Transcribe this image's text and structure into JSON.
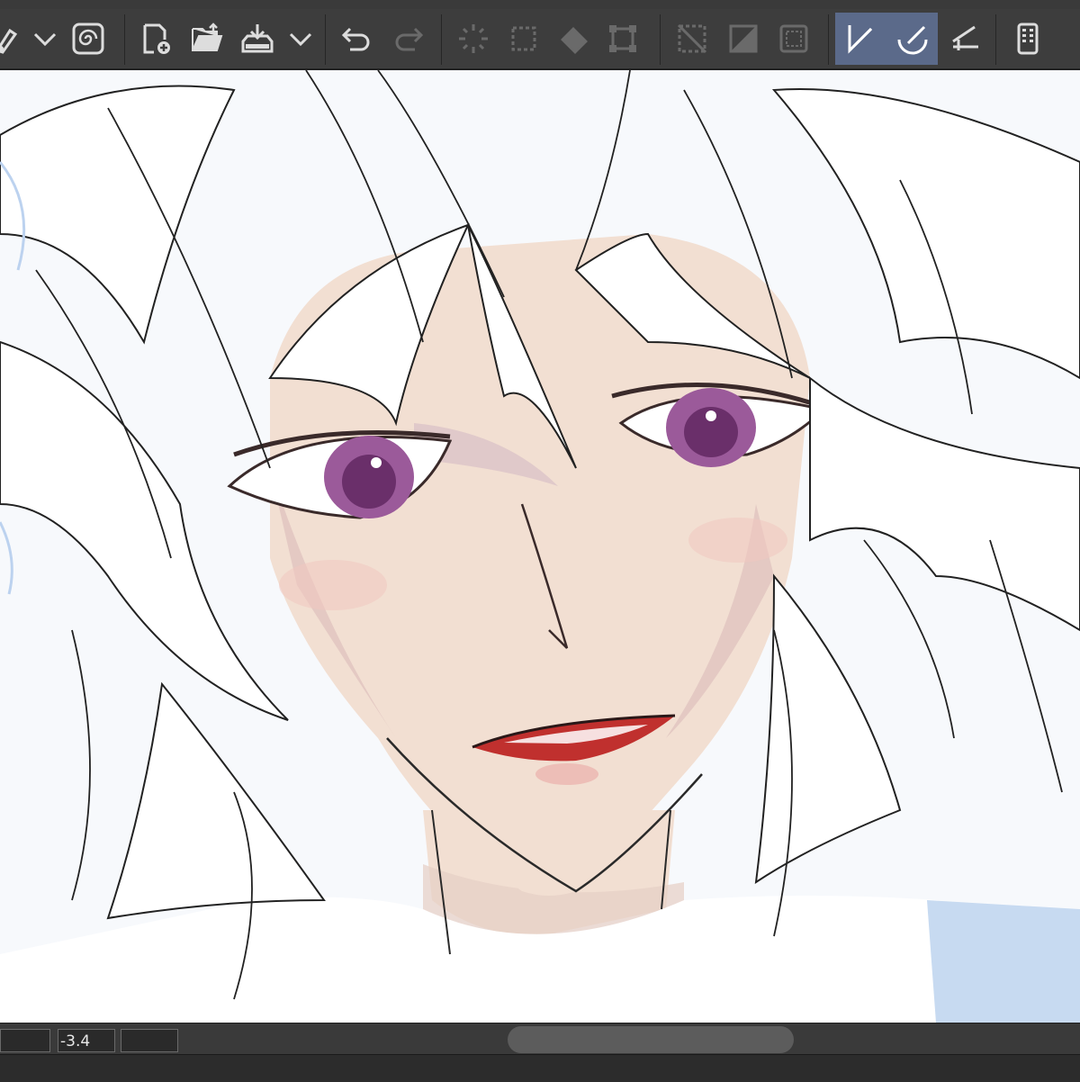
{
  "toolbar": {
    "icons": [
      "pen-icon",
      "dropdown-chevron-icon",
      "swirl-icon",
      "new-file-icon",
      "open-folder-icon",
      "import-icon",
      "dropdown-chevron-icon",
      "undo-icon",
      "redo-icon",
      "clear-selection-icon",
      "select-all-icon",
      "fill-icon",
      "transform-icon",
      "hide-selection-icon",
      "invert-selection-icon",
      "selection-border-icon",
      "ruler-snap-icon",
      "special-ruler-snap-icon",
      "grid-snap-icon",
      "tablet-icon"
    ],
    "active_tool": "ruler-snap-icon"
  },
  "status": {
    "zoom_value": "",
    "rotation_value": "-3.4",
    "blank_value": ""
  },
  "colors": {
    "ui_dark": "#3d3d3d",
    "active_highlight": "#5b6a8a",
    "canvas_bg": "#f7f9fc",
    "skin": "#f2dfd2",
    "iris": "#9b5a9a",
    "lips": "#c0302e",
    "sleeve_blue": "#c7daf1"
  }
}
